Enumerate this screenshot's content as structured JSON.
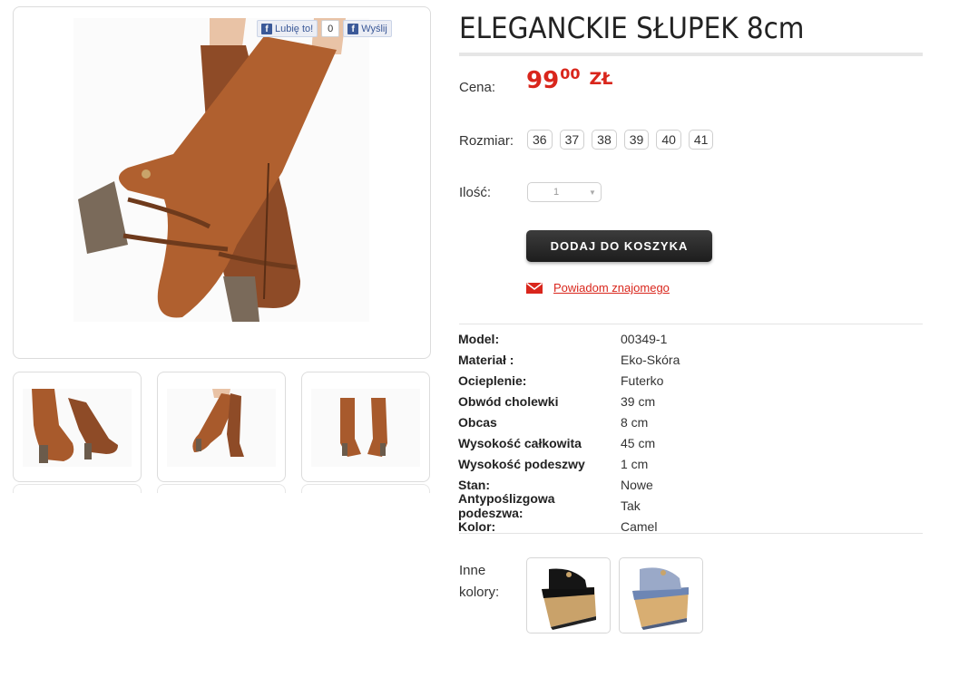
{
  "product": {
    "title": "ELEGANCKIE SŁUPEK 8cm",
    "price_label": "Cena:",
    "price_int": "99",
    "price_dec": "00",
    "currency": "ZŁ",
    "size_label": "Rozmiar:",
    "sizes": [
      "36",
      "37",
      "38",
      "39",
      "40",
      "41"
    ],
    "qty_label": "Ilość:",
    "qty_value": "1",
    "add_to_cart": "DODAJ DO KOSZYKA",
    "notify_friend": "Powiadom znajomego",
    "other_colors_label_line1": "Inne",
    "other_colors_label_line2": "kolory:"
  },
  "facebook": {
    "like_label": "Lubię to!",
    "like_count": "0",
    "send_label": "Wyślij"
  },
  "specs": [
    {
      "key": "Model:",
      "value": "00349-1"
    },
    {
      "key": "Materiał :",
      "value": "Eko-Skóra"
    },
    {
      "key": "Ocieplenie:",
      "value": "Futerko"
    },
    {
      "key": "Obwód cholewki",
      "value": "39 cm"
    },
    {
      "key": "Obcas",
      "value": "8 cm"
    },
    {
      "key": "Wysokość całkowita",
      "value": "45 cm"
    },
    {
      "key": "Wysokość podeszwy",
      "value": "1 cm"
    },
    {
      "key": "Stan:",
      "value": "Nowe"
    },
    {
      "key": "Antypoślizgowa podeszwa:",
      "value": "Tak"
    },
    {
      "key": "Kolor:",
      "value": "Camel"
    }
  ],
  "colors": {
    "accent": "#d9261c",
    "boot": "#a0522d",
    "button": "#2a2a2a",
    "facebook": "#3b5998"
  }
}
